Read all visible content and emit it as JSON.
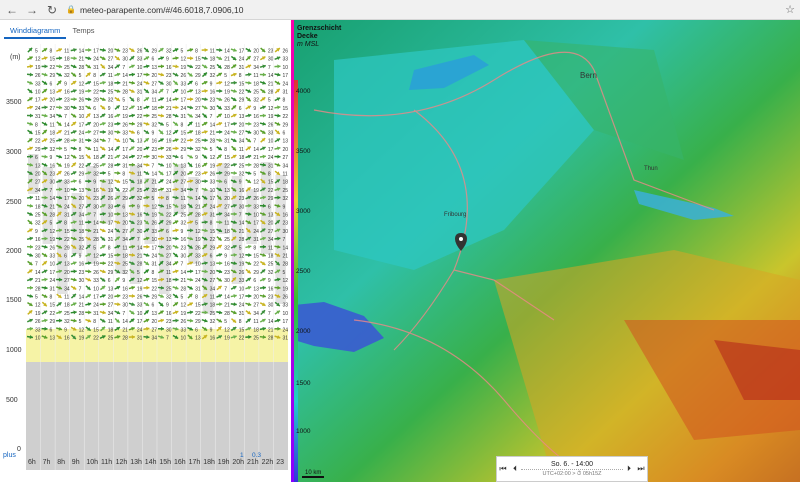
{
  "browser": {
    "url": "meteo-parapente.com/#/46.6018,7.0906,10"
  },
  "tabs": [
    {
      "label": "Winddiagramm"
    },
    {
      "label": "Temps"
    }
  ],
  "axis": {
    "unit": "(m)",
    "y_ticks": [
      "3500",
      "3000",
      "2500",
      "2000",
      "1500",
      "1000",
      "500",
      "0"
    ],
    "hours": [
      "6h",
      "7h",
      "8h",
      "9h",
      "10h",
      "11h",
      "12h",
      "13h",
      "14h",
      "15h",
      "16h",
      "17h",
      "18h",
      "19h",
      "20h",
      "21h",
      "22h",
      "23"
    ],
    "plus_label": "plus",
    "badges": [
      "1",
      "0.3"
    ]
  },
  "map": {
    "legend_line1": "Grenzschicht",
    "legend_line2": "Decke",
    "legend_line3": "m MSL",
    "scale_labels": [
      "4000",
      "3500",
      "3000",
      "2500",
      "2000",
      "1500",
      "1000"
    ],
    "scalebar": "10 km",
    "places": [
      "Bern",
      "Fribourg",
      "Thun"
    ]
  },
  "timebar": {
    "time": "So. 6. - 14:00",
    "utc": "UTC+02:00 > ⏱ 05h15Z"
  }
}
